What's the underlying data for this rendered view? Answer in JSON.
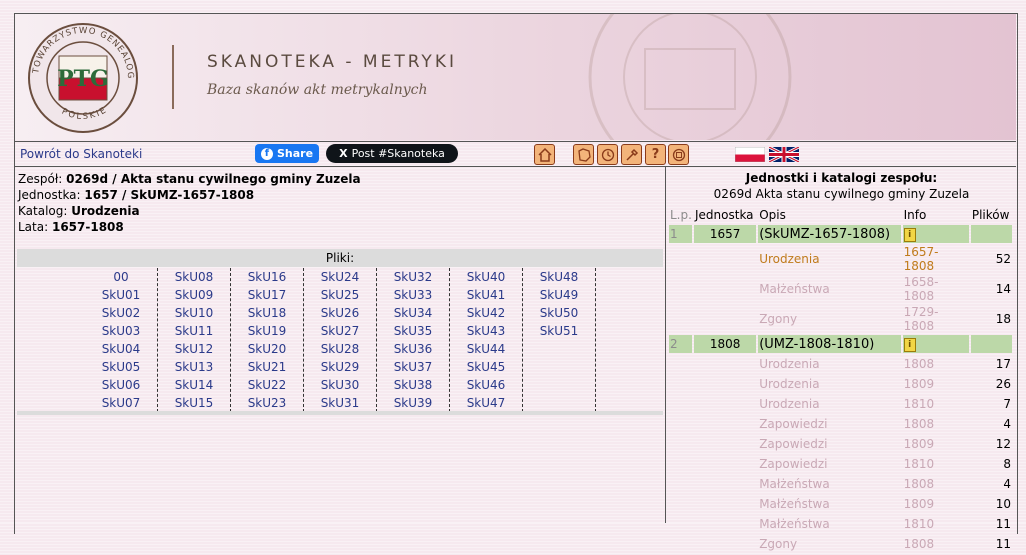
{
  "header": {
    "brand": "SKANOTEKA - METRYKI",
    "subtitle": "Baza skanów akt metrykalnych",
    "logo_ring_text": "TOWARZYSTWO GENEALOGICZNE",
    "logo_bottom_text": "POLSKIE",
    "logo_letters": "PTG"
  },
  "toolbar": {
    "back_label": "Powrót do Skanoteki",
    "fb_label": "Share",
    "x_label": "Post #Skanoteka",
    "icons": [
      "home-icon",
      "map-icon",
      "clock-icon",
      "tools-icon",
      "help-icon",
      "ptg-icon"
    ],
    "flags": [
      "poland-flag",
      "uk-flag"
    ]
  },
  "info": {
    "zespol_label": "Zespół:",
    "zespol_value": "0269d / Akta stanu cywilnego gminy Zuzela",
    "jednostka_label": "Jednostka:",
    "jednostka_value": "1657 / SkUMZ-1657-1808",
    "katalog_label": "Katalog:",
    "katalog_value": "Urodzenia",
    "lata_label": "Lata:",
    "lata_value": "1657-1808"
  },
  "files": {
    "heading": "Pliki:",
    "columns": [
      [
        "00",
        "SkU01",
        "SkU02",
        "SkU03",
        "SkU04",
        "SkU05",
        "SkU06",
        "SkU07"
      ],
      [
        "SkU08",
        "SkU09",
        "SkU10",
        "SkU11",
        "SkU12",
        "SkU13",
        "SkU14",
        "SkU15"
      ],
      [
        "SkU16",
        "SkU17",
        "SkU18",
        "SkU19",
        "SkU20",
        "SkU21",
        "SkU22",
        "SkU23"
      ],
      [
        "SkU24",
        "SkU25",
        "SkU26",
        "SkU27",
        "SkU28",
        "SkU29",
        "SkU30",
        "SkU31"
      ],
      [
        "SkU32",
        "SkU33",
        "SkU34",
        "SkU35",
        "SkU36",
        "SkU37",
        "SkU38",
        "SkU39"
      ],
      [
        "SkU40",
        "SkU41",
        "SkU42",
        "SkU43",
        "SkU44",
        "SkU45",
        "SkU46",
        "SkU47"
      ],
      [
        "SkU48",
        "SkU49",
        "SkU50",
        "SkU51"
      ]
    ]
  },
  "units": {
    "title": "Jednostki i katalogi zespołu:",
    "subtitle": "0269d Akta stanu cywilnego gminy Zuzela",
    "headers": {
      "lp": "L.p.",
      "jednostka": "Jednostka",
      "opis": "Opis",
      "info": "Info",
      "plikow": "Plików"
    },
    "rows": [
      {
        "kind": "unit",
        "lp": "1",
        "jednostka": "1657",
        "opis": "(SkUMZ-1657-1808)"
      },
      {
        "kind": "cat",
        "active": true,
        "opis": "Urodzenia",
        "lata": "1657-1808",
        "plikow": "52"
      },
      {
        "kind": "cat",
        "active": false,
        "opis": "Małżeństwa",
        "lata": "1658-1808",
        "plikow": "14"
      },
      {
        "kind": "cat",
        "active": false,
        "opis": "Zgony",
        "lata": "1729-1808",
        "plikow": "18"
      },
      {
        "kind": "unit",
        "lp": "2",
        "jednostka": "1808",
        "opis": "(UMZ-1808-1810)"
      },
      {
        "kind": "cat",
        "active": false,
        "opis": "Urodzenia",
        "lata": "1808",
        "plikow": "17"
      },
      {
        "kind": "cat",
        "active": false,
        "opis": "Urodzenia",
        "lata": "1809",
        "plikow": "26"
      },
      {
        "kind": "cat",
        "active": false,
        "opis": "Urodzenia",
        "lata": "1810",
        "plikow": "7"
      },
      {
        "kind": "cat",
        "active": false,
        "opis": "Zapowiedzi",
        "lata": "1808",
        "plikow": "4"
      },
      {
        "kind": "cat",
        "active": false,
        "opis": "Zapowiedzi",
        "lata": "1809",
        "plikow": "12"
      },
      {
        "kind": "cat",
        "active": false,
        "opis": "Zapowiedzi",
        "lata": "1810",
        "plikow": "8"
      },
      {
        "kind": "cat",
        "active": false,
        "opis": "Małżeństwa",
        "lata": "1808",
        "plikow": "4"
      },
      {
        "kind": "cat",
        "active": false,
        "opis": "Małżeństwa",
        "lata": "1809",
        "plikow": "10"
      },
      {
        "kind": "cat",
        "active": false,
        "opis": "Małżeństwa",
        "lata": "1810",
        "plikow": "11"
      },
      {
        "kind": "cat",
        "active": false,
        "opis": "Zgony",
        "lata": "1808",
        "plikow": "11"
      }
    ]
  }
}
